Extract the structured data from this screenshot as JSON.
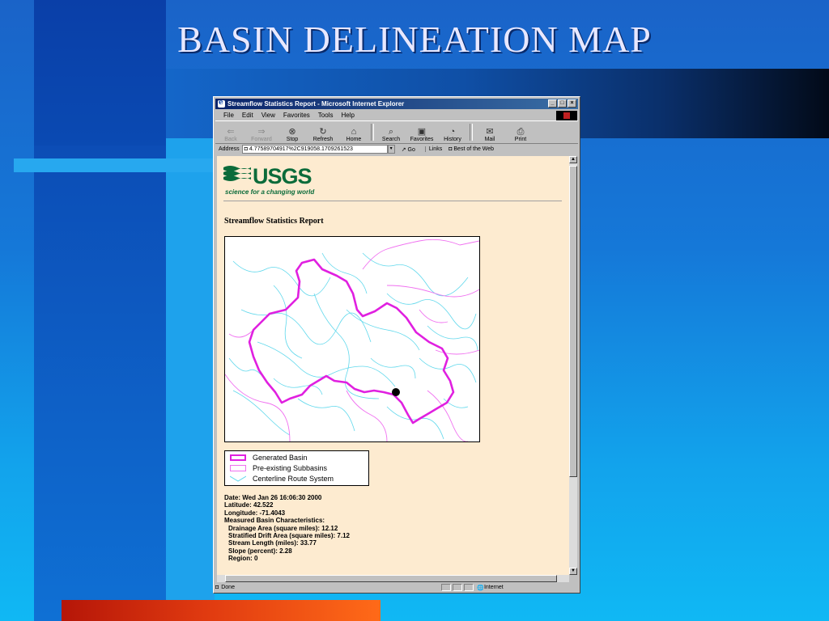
{
  "slide": {
    "title": "BASIN DELINEATION MAP"
  },
  "browser": {
    "window_title": "Streamflow Statistics Report - Microsoft Internet Explorer",
    "menu": [
      "File",
      "Edit",
      "View",
      "Favorites",
      "Tools",
      "Help"
    ],
    "toolbar": [
      {
        "label": "Back",
        "icon": "back-arrow-icon",
        "enabled": false
      },
      {
        "label": "Forward",
        "icon": "forward-arrow-icon",
        "enabled": false
      },
      {
        "label": "Stop",
        "icon": "stop-icon",
        "enabled": true
      },
      {
        "label": "Refresh",
        "icon": "refresh-icon",
        "enabled": true
      },
      {
        "label": "Home",
        "icon": "home-icon",
        "enabled": true
      },
      {
        "label": "Search",
        "icon": "search-icon",
        "enabled": true
      },
      {
        "label": "Favorites",
        "icon": "favorites-icon",
        "enabled": true
      },
      {
        "label": "History",
        "icon": "history-icon",
        "enabled": true
      },
      {
        "label": "Mail",
        "icon": "mail-icon",
        "enabled": true
      },
      {
        "label": "Print",
        "icon": "print-icon",
        "enabled": true
      }
    ],
    "address_label": "Address",
    "address_value": "4.77589704917%2C919058.1709261523",
    "go_label": "Go",
    "links_label": "Links",
    "bookmark_label": "Best of the Web",
    "status_text": "Done",
    "zone_text": "Internet"
  },
  "page": {
    "logo_text": "USGS",
    "logo_tagline": "science for a changing world",
    "report_title": "Streamflow Statistics Report",
    "legend": [
      {
        "label": "Generated Basin",
        "color": "#e020e0",
        "style": "thick-outline"
      },
      {
        "label": "Pre-existing Subbasins",
        "color": "#f070f0",
        "style": "thin-outline"
      },
      {
        "label": "Centerline Route System",
        "color": "#60d8ec",
        "style": "line"
      }
    ],
    "stats": {
      "date": "Date: Wed Jan 26 16:06:30 2000",
      "latitude": "Latitude: 42.522",
      "longitude": "Longitude: -71.4043",
      "heading": "Measured Basin Characteristics:",
      "drainage": "Drainage Area (square miles): 12.12",
      "stratified": "Stratified Drift Area (square miles): 7.12",
      "stream_length": "Stream Length (miles): 33.77",
      "slope": "Slope (percent): 2.28",
      "region": "Region: 0"
    }
  }
}
